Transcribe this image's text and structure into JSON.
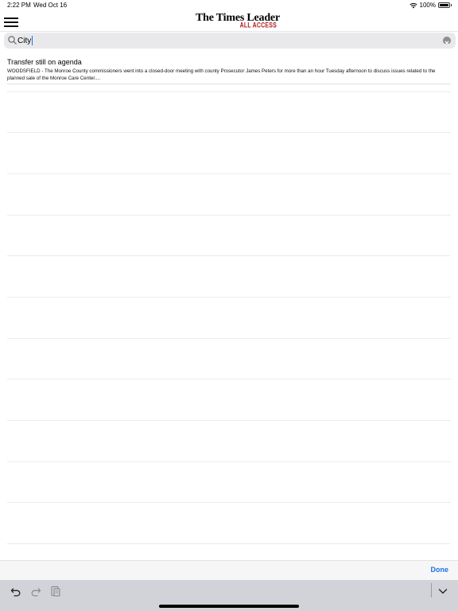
{
  "status_bar": {
    "time": "2:22 PM",
    "date": "Wed Oct 16",
    "battery_percent": "100%",
    "battery_level": 1.0
  },
  "header": {
    "logo_main": "The Times Leader",
    "logo_sub": "ALL ACCESS",
    "logo_sub_color": "#b31b1b",
    "menu_icon": "hamburger-menu-icon"
  },
  "search": {
    "value": "City",
    "placeholder": "",
    "search_icon": "search-icon",
    "clear_icon": "clear-icon"
  },
  "results": [
    {
      "title": "Transfer still on agenda",
      "summary": "WOODSFIELD - The Monroe County commissioners went into a closed-door meeting with county Prosecutor James Peters for more than an hour Tuesday afternoon to discuss issues related to the planned sale of the Monroe Care Center...."
    }
  ],
  "accessory_bar": {
    "done_label": "Done",
    "accent_color": "#1a73e8"
  },
  "keyboard": {
    "undo_icon": "undo-icon",
    "redo_icon": "redo-icon",
    "paste_icon": "paste-icon",
    "dismiss_icon": "chevron-down-icon"
  }
}
